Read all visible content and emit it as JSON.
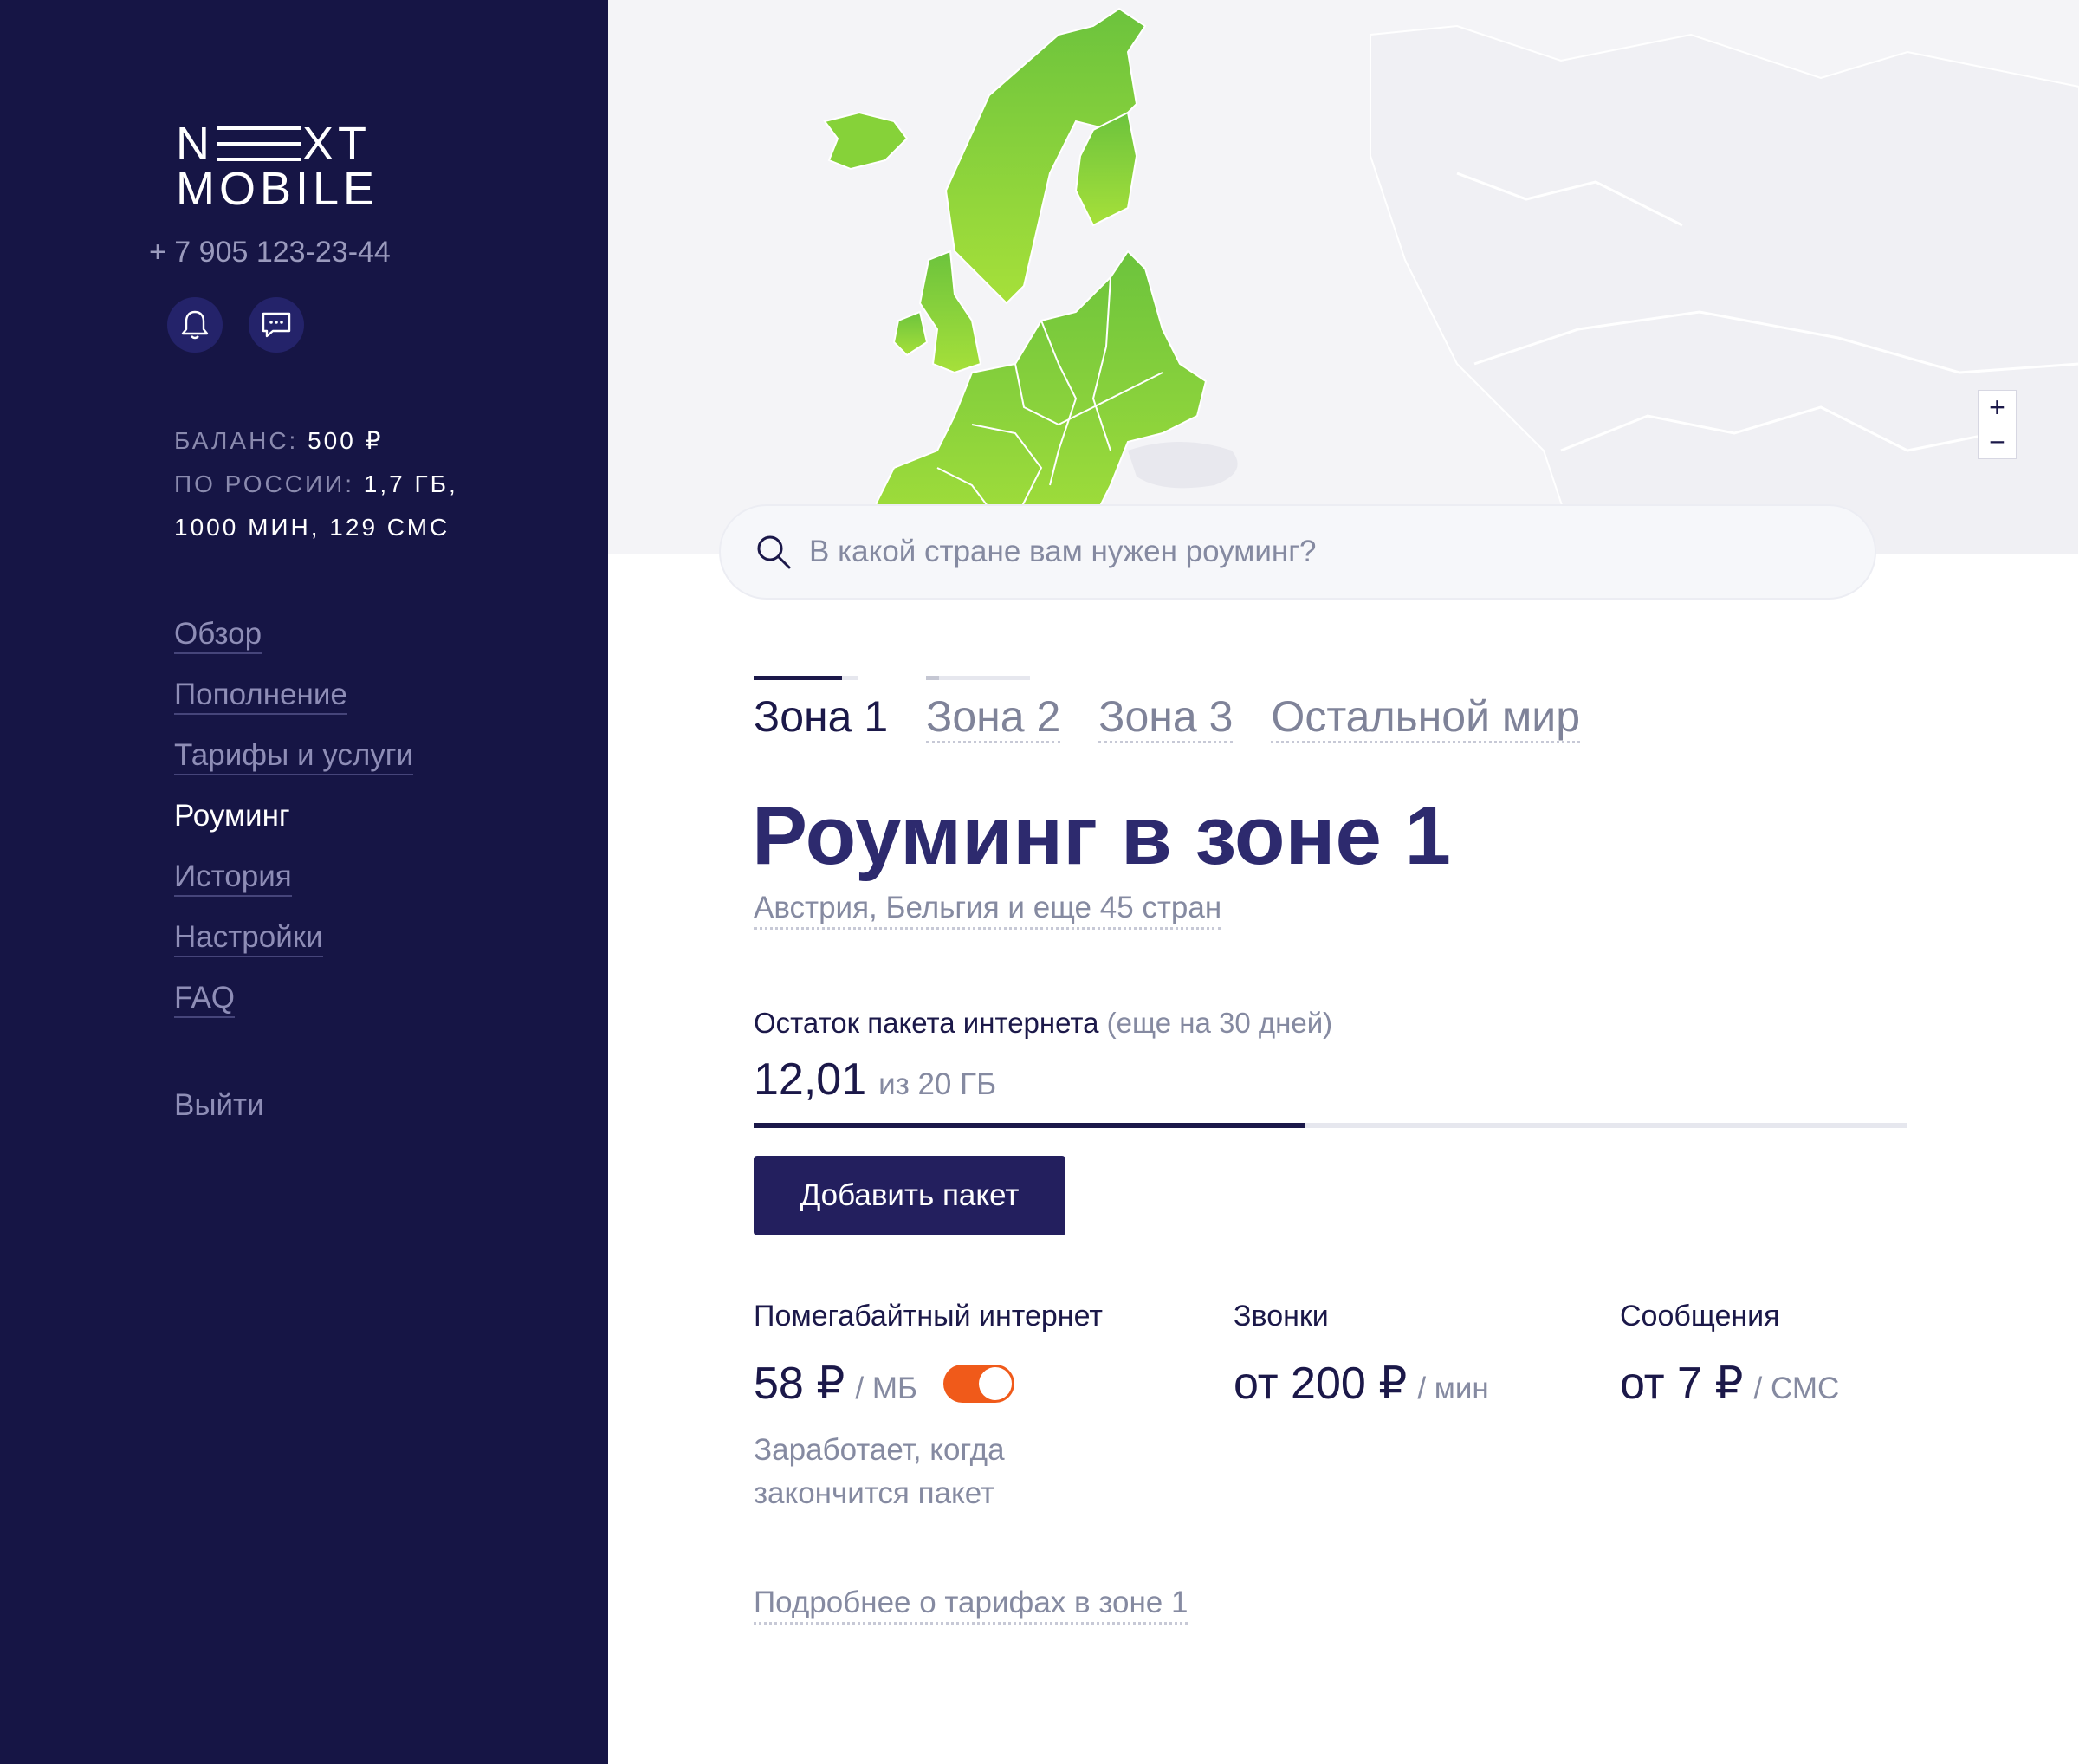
{
  "sidebar": {
    "logo": {
      "line1_left": "N",
      "line1_right": "XT",
      "line2": "MOBILE"
    },
    "phone": "+ 7 905 123-23-44",
    "icons": [
      "bell-icon",
      "chat-icon"
    ],
    "balance": {
      "label": "БАЛАНС:",
      "value": "500 ₽",
      "russia_label": "ПО РОССИИ:",
      "russia_value": "1,7 ГБ,",
      "russia_value2": "1000 МИН, 129 СМС"
    },
    "nav": [
      {
        "label": "Обзор"
      },
      {
        "label": "Пополнение"
      },
      {
        "label": "Тарифы и услуги"
      },
      {
        "label": "Роуминг",
        "active": true
      },
      {
        "label": "История"
      },
      {
        "label": "Настройки"
      },
      {
        "label": "FAQ"
      }
    ],
    "logout": "Выйти"
  },
  "map": {
    "zoom_in": "+",
    "zoom_out": "−",
    "highlight_color": "#8fd83c",
    "base_color": "#f4f4f7"
  },
  "search": {
    "placeholder": "В какой стране вам нужен роуминг?",
    "value": ""
  },
  "tabs": [
    {
      "label": "Зона 1",
      "active": true,
      "bar_fill": 0.85
    },
    {
      "label": "Зона 2",
      "active": false,
      "bar_fill": 0.12
    },
    {
      "label": "Зона 3",
      "active": false
    },
    {
      "label": "Остальной мир",
      "active": false
    }
  ],
  "zone": {
    "title": "Роуминг в зоне 1",
    "countries": "Австрия, Бельгия и еще 45 стран"
  },
  "package": {
    "label": "Остаток пакета интернета",
    "label_note": "(еще на 30 дней)",
    "remaining": "12,01",
    "total": "из 20 ГБ",
    "progress_fraction": 0.4785,
    "add_button": "Добавить пакет"
  },
  "prices": {
    "internet": {
      "label": "Помегабайтный интернет",
      "price": "58 ₽",
      "unit": "/ МБ",
      "toggle_on": true,
      "note": "Заработает, когда закончится пакет"
    },
    "calls": {
      "label": "Звонки",
      "price": "от 200 ₽",
      "unit": "/ мин"
    },
    "sms": {
      "label": "Сообщения",
      "price": "от 7 ₽",
      "unit": "/ СМС"
    }
  },
  "details_link": "Подробнее о тарифах в зоне 1",
  "colors": {
    "sidebar_bg": "#161545",
    "accent": "#231f5e",
    "toggle": "#f05a1a",
    "muted_text": "#858aa1"
  }
}
